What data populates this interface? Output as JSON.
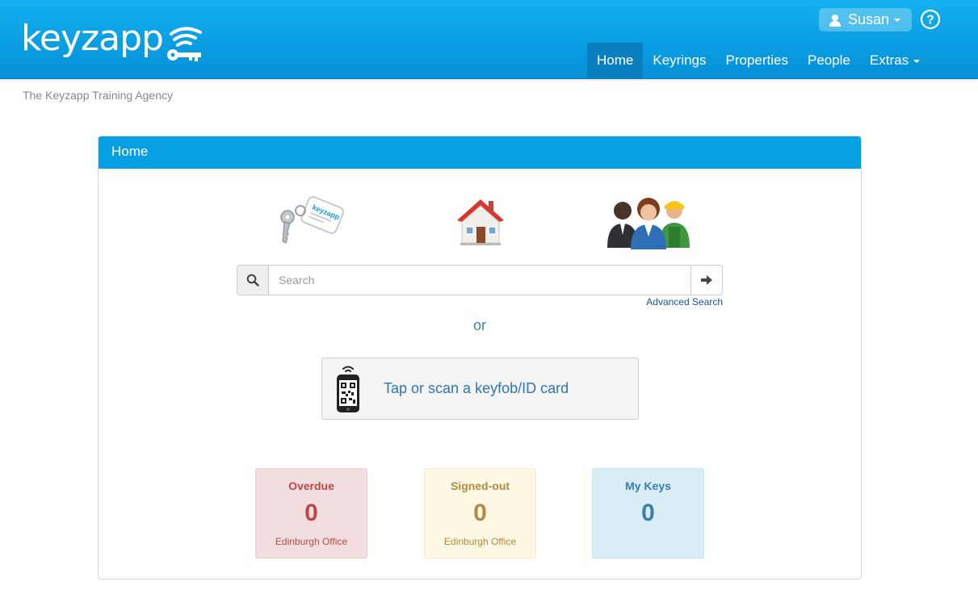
{
  "brand": {
    "logo_text": "keyzapp",
    "primary_color": "#0a9ee3",
    "logo_icon": "key-wifi-icon"
  },
  "user_menu": {
    "name": "Susan",
    "icon": "user-icon",
    "help_icon": "help-circle-icon"
  },
  "nav": {
    "items": [
      {
        "label": "Home",
        "active": true
      },
      {
        "label": "Keyrings",
        "active": false
      },
      {
        "label": "Properties",
        "active": false
      },
      {
        "label": "People",
        "active": false
      },
      {
        "label": "Extras",
        "active": false,
        "dropdown": true
      }
    ]
  },
  "agency_name": "The Keyzapp Training Agency",
  "panel": {
    "title": "Home",
    "quick_icons": [
      "keyring-icon",
      "house-icon",
      "people-icon"
    ],
    "search": {
      "placeholder": "Search",
      "value": "",
      "advanced_link": "Advanced Search"
    },
    "or_text": "or",
    "scan_button_label": "Tap or scan a keyfob/ID card",
    "keyfob_text": "keyzapp",
    "stats": [
      {
        "title": "Overdue",
        "value": "0",
        "subtitle": "Edinburgh Office",
        "color": "#b94a48"
      },
      {
        "title": "Signed-out",
        "value": "0",
        "subtitle": "Edinburgh Office",
        "color": "#b38a43"
      },
      {
        "title": "My Keys",
        "value": "0",
        "subtitle": "",
        "color": "#3a7fae"
      }
    ]
  }
}
